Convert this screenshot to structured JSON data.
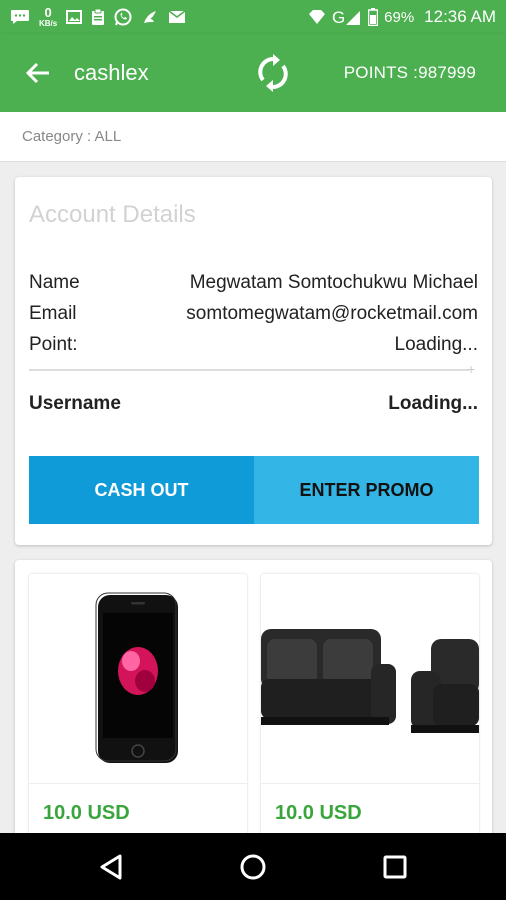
{
  "status_bar": {
    "data_speed_value": "0",
    "data_speed_unit": "KB/s",
    "battery_percent": "69%",
    "time": "12:36 AM",
    "icons": [
      "messages-icon",
      "image-icon",
      "clipboard-icon",
      "whatsapp-icon",
      "app-icon",
      "email-icon",
      "vibrate-icon",
      "wifi-icon",
      "signal-icon",
      "battery-icon"
    ]
  },
  "app_bar": {
    "title": "cashlex",
    "points_label": "POINTS :987999",
    "color": "#4caf50"
  },
  "category": {
    "label": "Category : ALL"
  },
  "account": {
    "title": "Account Details",
    "name_label": "Name",
    "name_value": "Megwatam Somtochukwu Michael",
    "email_label": "Email",
    "email_value": "somtomegwatam@rocketmail.com",
    "point_label": "Point:",
    "point_value": "Loading...",
    "username_label": "Username",
    "username_value": "Loading...",
    "cashout_label": "CASH OUT",
    "promo_label": "ENTER PROMO",
    "cashout_color": "#0f9bd7",
    "promo_color": "#33b5e5"
  },
  "products": [
    {
      "image": "smartphone-image",
      "price": "10.0 USD"
    },
    {
      "image": "leather-sofa-image",
      "price": "10.0 USD"
    }
  ],
  "nav": {
    "icons": [
      "back-triangle-icon",
      "home-circle-icon",
      "recents-square-icon"
    ]
  }
}
